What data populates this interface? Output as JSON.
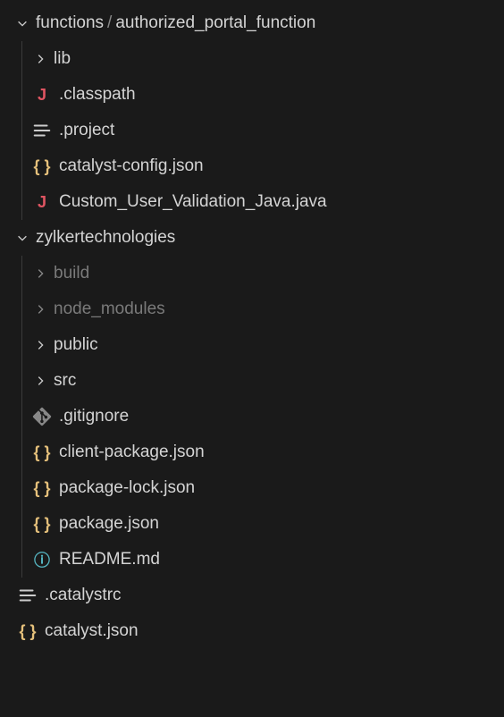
{
  "tree": {
    "folder1": {
      "path_a": "functions",
      "path_b": "authorized_portal_function",
      "children": {
        "lib": "lib",
        "classpath": ".classpath",
        "project": ".project",
        "catalystConfig": "catalyst-config.json",
        "customValidation": "Custom_User_Validation_Java.java"
      }
    },
    "folder2": {
      "name": "zylkertechnologies",
      "children": {
        "build": "build",
        "nodeModules": "node_modules",
        "public": "public",
        "src": "src",
        "gitignore": ".gitignore",
        "clientPackage": "client-package.json",
        "packageLock": "package-lock.json",
        "packageJson": "package.json",
        "readme": "README.md"
      }
    },
    "root": {
      "catalystrc": ".catalystrc",
      "catalystJson": "catalyst.json"
    }
  },
  "icons": {
    "java": "J",
    "json": "{ }",
    "info": "ⓘ"
  }
}
